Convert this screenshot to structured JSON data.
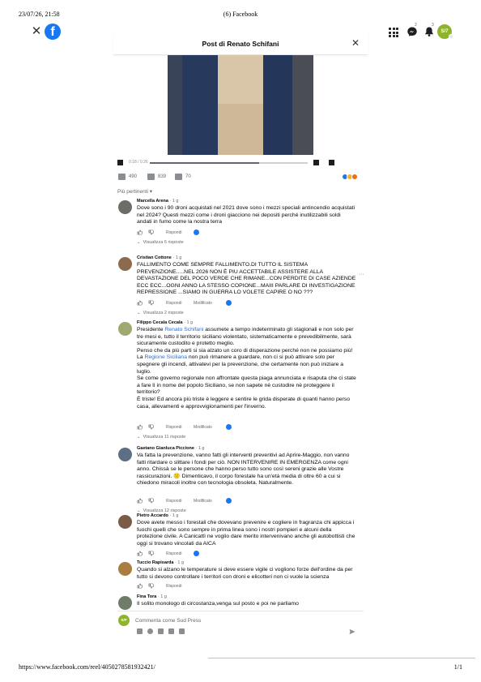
{
  "print": {
    "timestamp": "23/07/26, 21:58",
    "title": "(6) Facebook",
    "url": "https://www.facebook.com/reel/4050278581932421/",
    "page": "1/1"
  },
  "topbar": {
    "avatar_initials": "S/7",
    "messenger_badge": "2",
    "notifications_badge": "3"
  },
  "modal": {
    "title": "Post di Renato Schifani",
    "video": {
      "time": "0:18 / 0:26",
      "progress": 0.69
    },
    "stats": {
      "likes": "490",
      "comments": "839",
      "shares": "70"
    },
    "sort_label": "Più pertinenti"
  },
  "comments": [
    {
      "author": "Marcella Arena",
      "time": "1 g",
      "text": [
        "Dove sono i 90 droni acquistati nel 2021 dove sono i mezzi speciali antincendio acquistati nel 2024? Questi mezzi come i droni giacciono nei depositi perché inutilizzabili soldi andati in fumo come la nostra terra"
      ],
      "reply": "Rispondi",
      "edited": "",
      "replies": "Visualizza 6 risposte"
    },
    {
      "author": "Cristian Cottone",
      "time": "1 g",
      "text": [
        "FALLIMENTO COME SEMPRE FALLIMENTO.DI TUTTO IL SISTEMA PREVENZIONE.....NEL 2026 NON È PIU ACCETTABILE ASSISTERE ALLA DEVASTAZIONE DEL POCO VERDE CHE RIMANE...CON PERDITE DI CASE AZIENDE ECC ECC...OGNI ANNO LA STESSO COPIONE...MAIII PARLARE DI INVESTIGAZIONE REPRESSIONE ...SIAMO IN GUERRA LO VOLETE CAPIRE O NO ???"
      ],
      "reply": "Rispondi",
      "edited": "Modificato",
      "replies": "Visualizza 2 risposte"
    },
    {
      "author": "Filippo Cecala Cecala",
      "time": "1 g",
      "p1_pre": "Presidente ",
      "p1_link": "Renato Schifani",
      "p1_post": " assumete a tempo indeterminato gli stagionali e non solo per tre mesi e, tutto il territorio siciliano violentato, sistematicamente e prevedibilmente, sarà sicuramente custodito e protetto meglio.",
      "p2": "Penso che da più parti si sia alzato un coro di disperazione perché non ne possiamo più!",
      "p3_pre": "La ",
      "p3_link": "Regione Siciliana",
      "p3_post": " non può rimanere a guardare, non ci si può attivare solo per spegnere gli incendi, attivatevi per la prevenzione, che certamente non può iniziare a luglio.",
      "p4": "Se come governo regionale non affrontate questa piaga annunciata e risaputa che ci state a fare lì in nome del popolo Siciliano, se non sapete nè custodire nè proteggere il territorio?",
      "p5": "È triste! Ed ancora più triste è leggere e sentire le grida disperate di quanti hanno perso casa, allevamenti e approvvigionamenti per l'inverno.",
      "reply": "Rispondi",
      "edited": "Modificato",
      "replies": "Visualizza 11 risposte"
    },
    {
      "author": "Gaetano Gianluca Piccione",
      "time": "1 g",
      "text": [
        "Va fatta la prevenzione, vanno fatti gli interventi preventivi ad Aprire-Maggio, non vanno fatti ritardare o slittare i fondi per ciò. NON INTERVENIRE IN EMERGENZA come ogni anno. Chissà se le persone che hanno perso tutto sono così sereni grazie alle Vostre rassicurazioni. 🙁 Dimenticavo, il corpo forestale ha un'età media di oltre 60 a cui si chiedono miracoli inoltre con tecnologia obsoleta. Naturalmente."
      ],
      "reply": "Rispondi",
      "edited": "Modificato",
      "replies": "Visualizza 12 risposte"
    },
    {
      "author": "Pietro Accardo",
      "time": "1 g",
      "text": [
        "Dove avete messo i forestali che dovevano prevenire e cogliere in fragranza chi appicca i fuochi quelli che sono sempre in prima linea sono i nostri pompieri e alcuni della protezione civile. A Canicattì ne voglio dare merito intervenivano anche gli autobottisti che oggi si trovano vincolati da AICA"
      ],
      "reply": "Rispondi",
      "edited": "",
      "replies": ""
    },
    {
      "author": "Tuccio Rapisarda",
      "time": "1 g",
      "text": [
        "Quando si alzano le temperature si deve essere vigile ci vogliono forze dell'ordine da per tutto si devono controllare i territori con droni e elicotteri non ci vuole la scienza"
      ],
      "reply": "Rispondi",
      "edited": "",
      "replies": ""
    },
    {
      "author": "Fina Tora",
      "time": "1 g",
      "text": [
        "Il solito monologo di circostanza,venga sul posto e poi ne parliamo"
      ],
      "reply": "",
      "edited": "",
      "replies": ""
    }
  ],
  "composer": {
    "avatar_initials": "S/P",
    "placeholder": "Commenta come Sud Press"
  },
  "colors": {
    "facebook_blue": "#1877f2",
    "link_blue": "#216fdb",
    "avatar_green": "#8fb32f",
    "muted_text": "#65676b"
  }
}
